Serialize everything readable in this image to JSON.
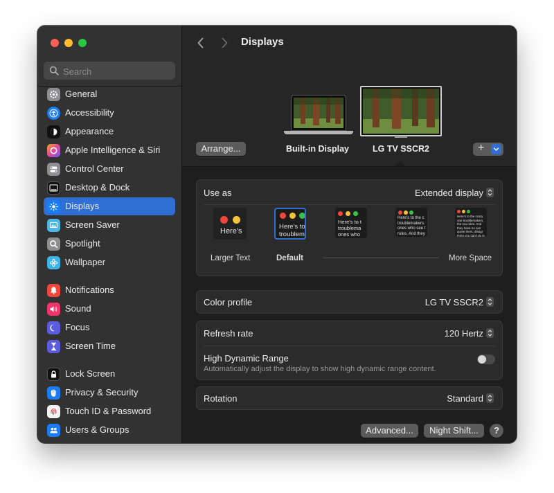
{
  "window": {
    "title": "Displays"
  },
  "search": {
    "placeholder": "Search"
  },
  "sidebar": {
    "items": [
      {
        "label": "General",
        "icon": "gear-icon",
        "color": "#8e8e93"
      },
      {
        "label": "Accessibility",
        "icon": "accessibility-icon",
        "color": "#1a7df5"
      },
      {
        "label": "Appearance",
        "icon": "appearance-icon",
        "color": "#111111"
      },
      {
        "label": "Apple Intelligence & Siri",
        "icon": "siri-icon",
        "color": "#d06be0"
      },
      {
        "label": "Control Center",
        "icon": "control-center-icon",
        "color": "#8e8e93"
      },
      {
        "label": "Desktop & Dock",
        "icon": "dock-icon",
        "color": "#111111"
      },
      {
        "label": "Displays",
        "icon": "sun-icon",
        "color": "#1a7df5"
      },
      {
        "label": "Screen Saver",
        "icon": "screen-saver-icon",
        "color": "#4cb8e8"
      },
      {
        "label": "Spotlight",
        "icon": "spotlight-icon",
        "color": "#8e8e93"
      },
      {
        "label": "Wallpaper",
        "icon": "wallpaper-icon",
        "color": "#3bb6e6"
      },
      {
        "label": "Notifications",
        "icon": "bell-icon",
        "color": "#f0473d"
      },
      {
        "label": "Sound",
        "icon": "speaker-icon",
        "color": "#f0356a"
      },
      {
        "label": "Focus",
        "icon": "moon-icon",
        "color": "#5b5ce0"
      },
      {
        "label": "Screen Time",
        "icon": "hourglass-icon",
        "color": "#5b5ce0"
      },
      {
        "label": "Lock Screen",
        "icon": "lock-icon",
        "color": "#111111"
      },
      {
        "label": "Privacy & Security",
        "icon": "hand-icon",
        "color": "#1a7df5"
      },
      {
        "label": "Touch ID & Password",
        "icon": "fingerprint-icon",
        "color": "#f2f2f2"
      },
      {
        "label": "Users & Groups",
        "icon": "users-icon",
        "color": "#1a7df5"
      }
    ],
    "active_index": 6,
    "accent": "#2f6fd3"
  },
  "header": {
    "arrange_label": "Arrange...",
    "displays": [
      {
        "label": "Built-in Display"
      },
      {
        "label": "LG TV SSCR2",
        "selected": true
      }
    ],
    "add_label": "+"
  },
  "use_as": {
    "label": "Use as",
    "value": "Extended display",
    "resolution_options": [
      {
        "caption": "Larger Text",
        "sample": "Here's"
      },
      {
        "caption": "Default",
        "sample": "Here's to troublem",
        "selected": true
      },
      {
        "caption": "",
        "sample": "Here's to t troublema ones who"
      },
      {
        "caption": "",
        "sample": "Here's to the c troublemakers. ones who see t rules. And they"
      },
      {
        "caption": "More Space",
        "sample": "Here's to the crazy one troublemakers, the rou rules. And they have no can quote them, disagr thing you can't do is ig Because they change th"
      }
    ]
  },
  "color_profile": {
    "label": "Color profile",
    "value": "LG TV SSCR2"
  },
  "refresh_rate": {
    "label": "Refresh rate",
    "value": "120 Hertz"
  },
  "hdr": {
    "label": "High Dynamic Range",
    "description": "Automatically adjust the display to show high dynamic range content.",
    "enabled": false
  },
  "rotation": {
    "label": "Rotation",
    "value": "Standard"
  },
  "footer": {
    "advanced_label": "Advanced...",
    "night_shift_label": "Night Shift...",
    "help_label": "?"
  }
}
